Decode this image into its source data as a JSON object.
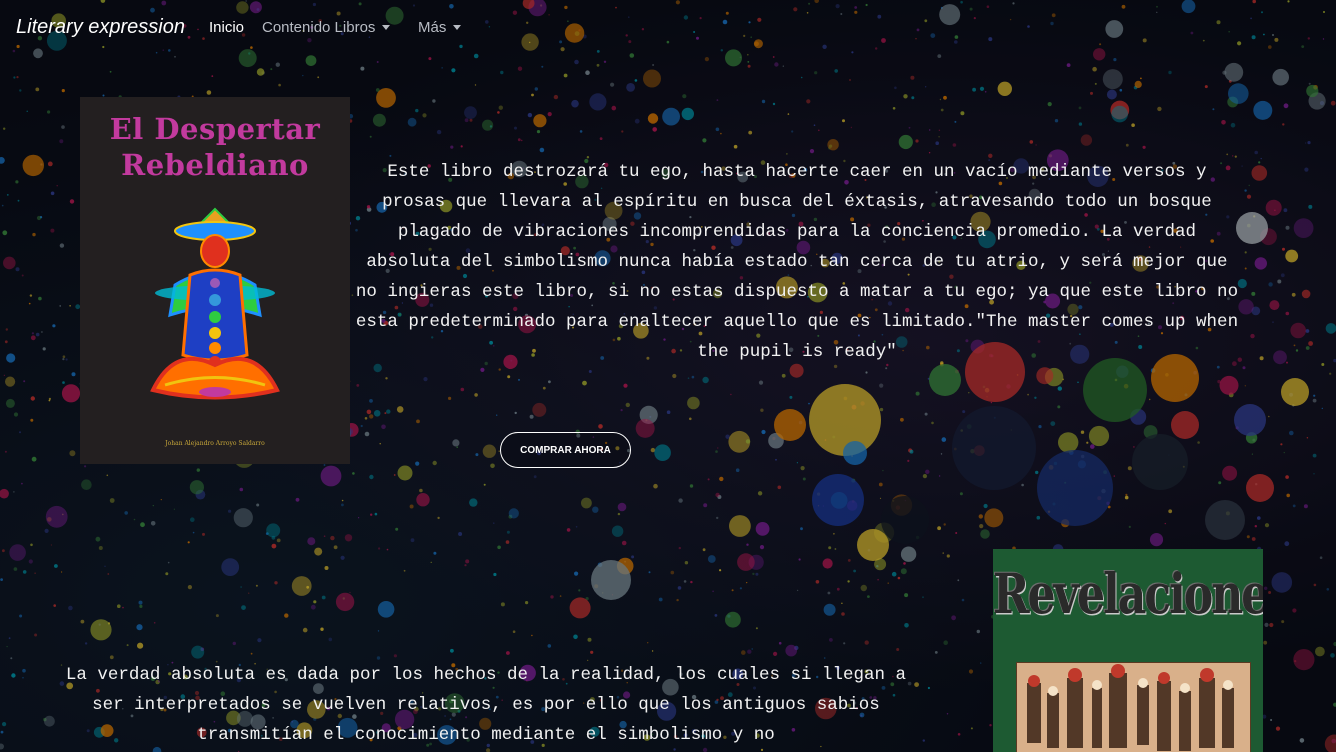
{
  "navbar": {
    "brand": "Literary expression",
    "items": [
      {
        "label": "Inicio",
        "active": true
      },
      {
        "label": "Contenido Libros",
        "dropdown": true
      },
      {
        "label": "Más",
        "dropdown": true
      }
    ]
  },
  "books": [
    {
      "cover_title_line1": "El Despertar",
      "cover_title_line2": "Rebeldiano",
      "cover_author": "Johan Alejandro Arroyo Saldarro",
      "description": "Este libro destrozará tu ego, hasta hacerte caer en un vacío mediante versos y prosas que llevara al espíritu en busca del éxtasis, atravesando todo un bosque plagado de vibraciones incomprendidas para la conciencia promedio. La verdad absoluta del simbolismo nunca había estado tan cerca de tu atrio, y será mejor que no ingieras este libro, si no estas dispuesto a matar a tu ego; ya que este libro no esta predeterminado para enaltecer aquello que es limitado.\"The master comes up when the pupil is ready\"",
      "buy_label": "COMPRAR AHORA"
    },
    {
      "cover_title": "Revelaciones",
      "description": "La verdad absoluta es dada por los hechos de la realidad, los cuales si llegan a ser interpretados se vuelven relativos, es por ello que los antiguos sabios transmitían el conocimiento mediante el simbolismo y no"
    }
  ],
  "colors": {
    "background": "#0a0d18",
    "cover1_bg": "#231f20",
    "cover1_title": "#c23a9e",
    "cover2_bg": "#1d5a32",
    "nav_inactive": "#b8bcc4"
  }
}
